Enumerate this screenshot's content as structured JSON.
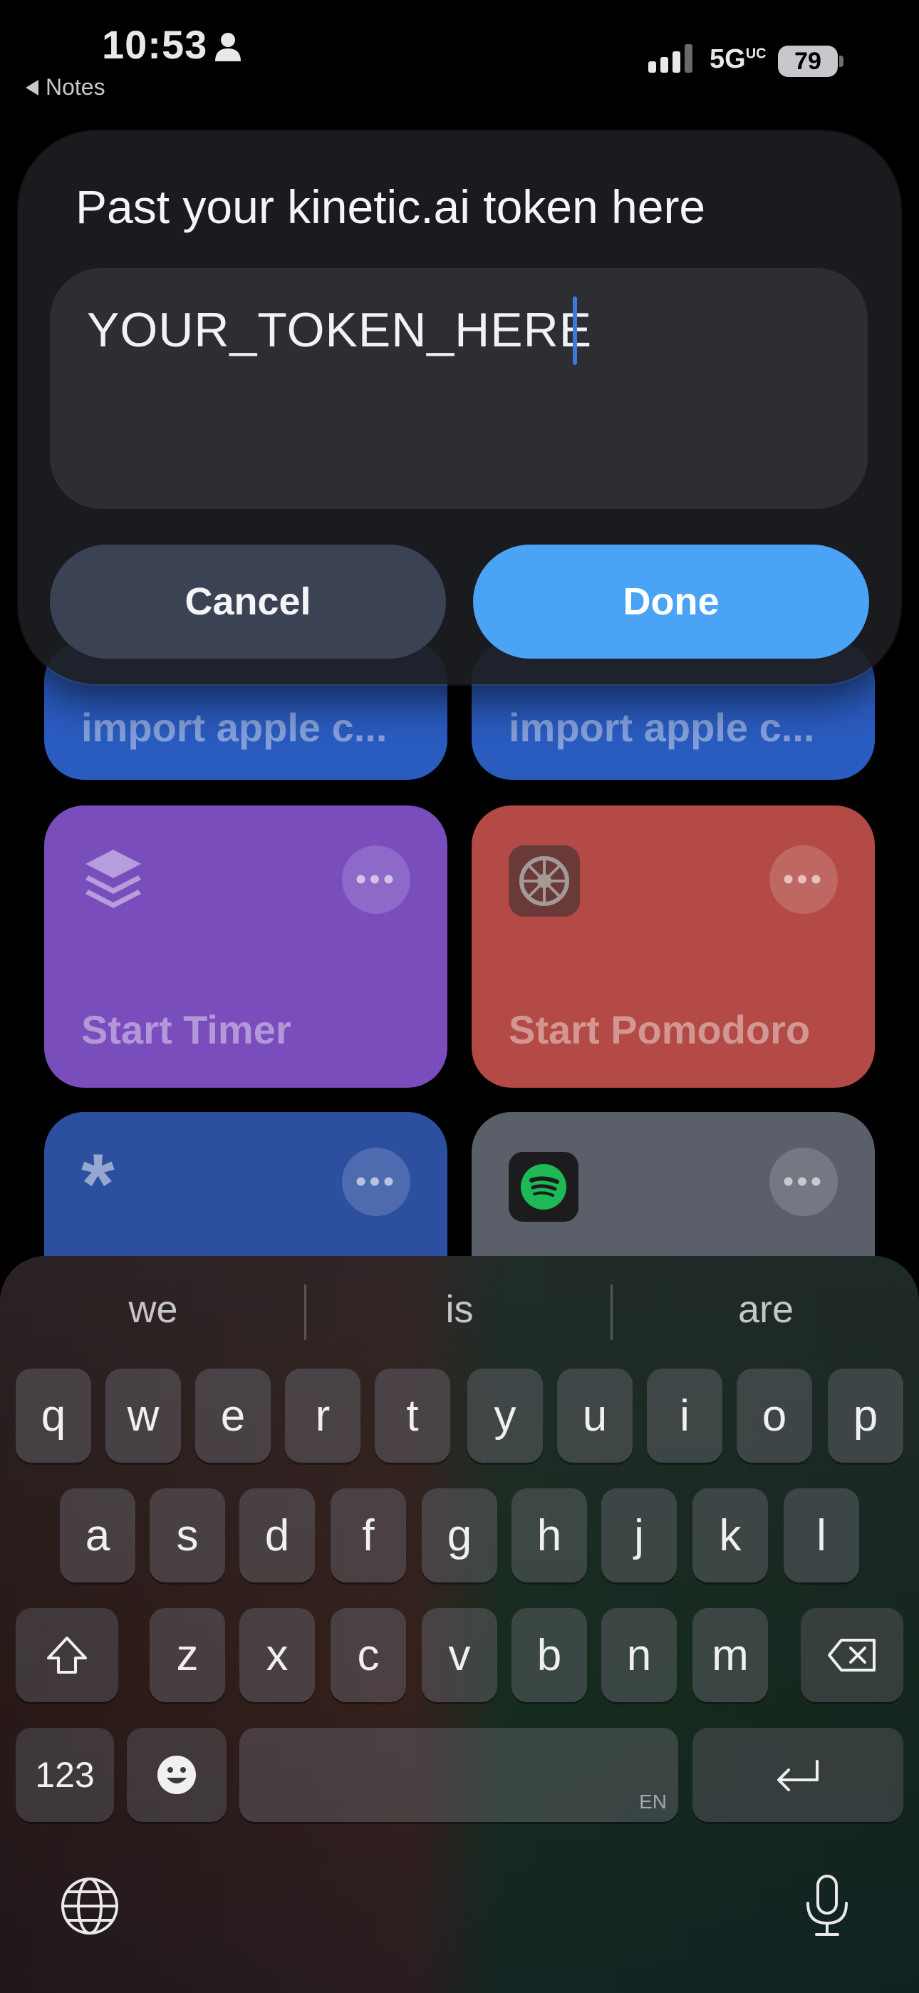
{
  "status_bar": {
    "time": "10:53",
    "back_label": "Notes",
    "network": "5G",
    "network_suffix": "UC",
    "battery": "79"
  },
  "tiles": [
    {
      "label": "import apple c...",
      "color": "#2a5bbf"
    },
    {
      "label": "import apple c...",
      "color": "#2a5bbf"
    },
    {
      "label": "Start Timer",
      "color": "#7a4dbd",
      "icon": "layers-icon"
    },
    {
      "label": "Start Pomodoro",
      "color": "#b34a45",
      "icon": "settings-gear-icon"
    },
    {
      "label": "",
      "color": "#2d4fa0",
      "icon": "asterisk-icon"
    },
    {
      "label": "",
      "color": "#5b5f6a",
      "icon": "spotify-icon"
    }
  ],
  "dialog": {
    "title": "Past your kinetic.ai token here",
    "value": "YOUR_TOKEN_HERE",
    "cancel_label": "Cancel",
    "done_label": "Done"
  },
  "keyboard": {
    "suggestions": [
      "we",
      "is",
      "are"
    ],
    "row1": [
      "q",
      "w",
      "e",
      "r",
      "t",
      "y",
      "u",
      "i",
      "o",
      "p"
    ],
    "row2": [
      "a",
      "s",
      "d",
      "f",
      "g",
      "h",
      "j",
      "k",
      "l"
    ],
    "row3": [
      "z",
      "x",
      "c",
      "v",
      "b",
      "n",
      "m"
    ],
    "numbers_label": "123",
    "space_lang": "EN"
  },
  "colors": {
    "done_button": "#4aa3f4",
    "caret": "#3d7bd9"
  }
}
